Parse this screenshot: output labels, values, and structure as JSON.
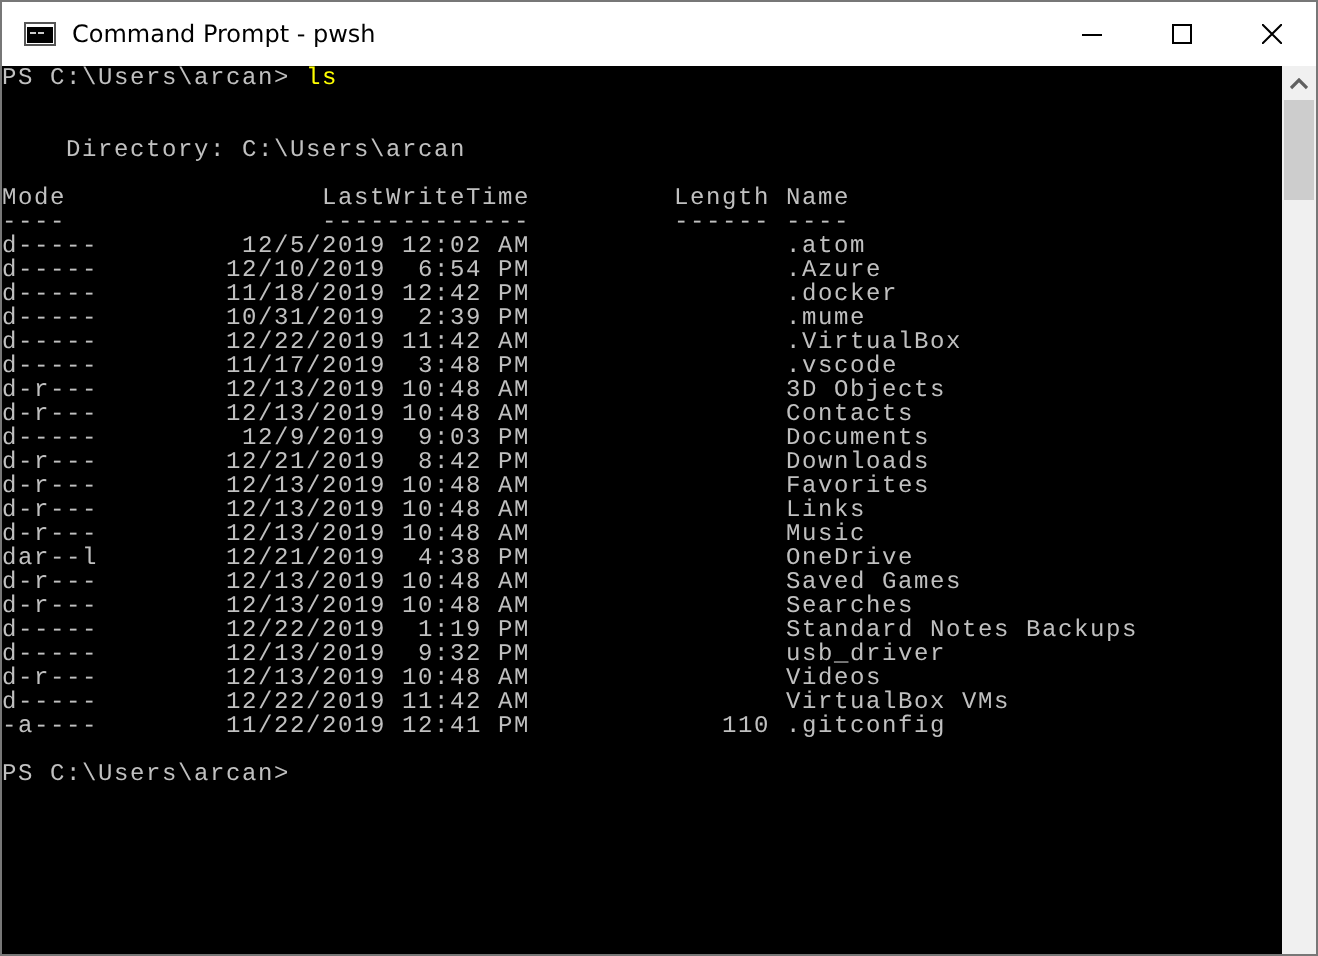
{
  "window": {
    "title": "Command Prompt - pwsh"
  },
  "prompt": {
    "path": "PS C:\\Users\\arcan>",
    "command": "ls"
  },
  "directory": "Directory: C:\\Users\\arcan",
  "columns": [
    {
      "label": "Mode",
      "underline": "----"
    },
    {
      "label": "LastWriteTime",
      "underline": "-------------"
    },
    {
      "label": "Length",
      "underline": "------"
    },
    {
      "label": "Name",
      "underline": "----"
    }
  ],
  "rows": [
    {
      "mode": "d-----",
      "time": "12/5/2019 12:02 AM",
      "name": ".atom"
    },
    {
      "mode": "d-----",
      "time": "12/10/2019  6:54 PM",
      "name": ".Azure"
    },
    {
      "mode": "d-----",
      "time": "11/18/2019 12:42 PM",
      "name": ".docker"
    },
    {
      "mode": "d-----",
      "time": "10/31/2019  2:39 PM",
      "name": ".mume"
    },
    {
      "mode": "d-----",
      "time": "12/22/2019 11:42 AM",
      "name": ".VirtualBox"
    },
    {
      "mode": "d-----",
      "time": "11/17/2019  3:48 PM",
      "name": ".vscode"
    },
    {
      "mode": "d-r---",
      "time": "12/13/2019 10:48 AM",
      "name": "3D Objects"
    },
    {
      "mode": "d-r---",
      "time": "12/13/2019 10:48 AM",
      "name": "Contacts"
    },
    {
      "mode": "d-----",
      "time": "12/9/2019  9:03 PM",
      "name": "Documents"
    },
    {
      "mode": "d-r---",
      "time": "12/21/2019  8:42 PM",
      "name": "Downloads"
    },
    {
      "mode": "d-r---",
      "time": "12/13/2019 10:48 AM",
      "name": "Favorites"
    },
    {
      "mode": "d-r---",
      "time": "12/13/2019 10:48 AM",
      "name": "Links"
    },
    {
      "mode": "d-r---",
      "time": "12/13/2019 10:48 AM",
      "name": "Music"
    },
    {
      "mode": "dar--l",
      "time": "12/21/2019  4:38 PM",
      "name": "OneDrive"
    },
    {
      "mode": "d-r---",
      "time": "12/13/2019 10:48 AM",
      "name": "Saved Games"
    },
    {
      "mode": "d-r---",
      "time": "12/13/2019 10:48 AM",
      "name": "Searches"
    },
    {
      "mode": "d-----",
      "time": "12/22/2019  1:19 PM",
      "name": "Standard Notes Backups"
    },
    {
      "mode": "d-----",
      "time": "12/13/2019  9:32 PM",
      "name": "usb_driver"
    },
    {
      "mode": "d-r---",
      "time": "12/13/2019 10:48 AM",
      "name": "Videos"
    },
    {
      "mode": "d-----",
      "time": "12/22/2019 11:42 AM",
      "name": "VirtualBox VMs"
    },
    {
      "mode": "-a----",
      "time": "11/22/2019 12:41 PM",
      "length": "110",
      "name": ".gitconfig"
    }
  ],
  "next_prompt": "PS C:\\Users\\arcan>"
}
